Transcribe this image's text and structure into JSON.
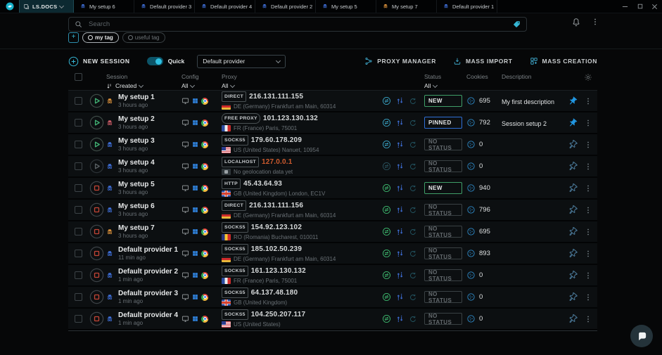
{
  "titlebar": {
    "app_label": "LS.DOCS",
    "tabs": [
      {
        "label": "My setup 6",
        "icon_color": "#3e6ed6"
      },
      {
        "label": "Default provider 3",
        "icon_color": "#3e6ed6"
      },
      {
        "label": "Default provider 4",
        "icon_color": "#3e6ed6"
      },
      {
        "label": "Default provider 2",
        "icon_color": "#3e6ed6"
      },
      {
        "label": "My setup 5",
        "icon_color": "#3e6ed6"
      },
      {
        "label": "My setup 7",
        "icon_color": "#d88f3a"
      },
      {
        "label": "Default provider 1",
        "icon_color": "#3e6ed6"
      }
    ]
  },
  "search": {
    "placeholder": "Search"
  },
  "tags": [
    {
      "label": "my tag",
      "active": true
    },
    {
      "label": "useful tag",
      "active": false
    }
  ],
  "toolbar": {
    "new_session": "NEW SESSION",
    "quick": "Quick",
    "provider": "Default provider",
    "proxy_manager": "PROXY MANAGER",
    "mass_import": "MASS IMPORT",
    "mass_creation": "MASS CREATION"
  },
  "table": {
    "header": {
      "session": "Session",
      "created": "Created",
      "config": "Config",
      "proxy": "Proxy",
      "status": "Status",
      "cookies": "Cookies",
      "description": "Description",
      "filter_all": "All"
    },
    "rows": [
      {
        "name": "My setup 1",
        "created": "3 hours ago",
        "person_color": "#d88f3a",
        "button": "play",
        "proxy_type": "DIRECT",
        "pill": false,
        "ip": "216.131.111.155",
        "ip_warn": false,
        "flag": "de",
        "geo": "DE (Germany) Frankfurt am Main, 60314",
        "check": "teal",
        "status_label": "NEW",
        "status_type": "new",
        "cookies": "695",
        "description": "My first description",
        "pinned": true
      },
      {
        "name": "My setup 2",
        "created": "3 hours ago",
        "person_color": "#c85b66",
        "button": "play",
        "proxy_type": "FREE PROXY",
        "pill": true,
        "ip": "101.123.130.132",
        "ip_warn": false,
        "flag": "fr",
        "geo": "FR (France) Paris, 75001",
        "check": "teal",
        "status_label": "PINNED",
        "status_type": "pinned",
        "cookies": "792",
        "description": "Session setup 2",
        "pinned": true
      },
      {
        "name": "My setup 3",
        "created": "3 hours ago",
        "person_color": "#3e6ed6",
        "button": "play",
        "proxy_type": "SOCKS5",
        "pill": false,
        "ip": "179.60.178.209",
        "ip_warn": false,
        "flag": "us",
        "geo": "US (United States) Nanuet, 10954",
        "check": "teal",
        "status_label": "NO STATUS",
        "status_type": "none",
        "cookies": "0",
        "description": "",
        "pinned": false
      },
      {
        "name": "My setup 4",
        "created": "3 hours ago",
        "person_color": "#3e6ed6",
        "button": "play-disabled",
        "proxy_type": "LOCALHOST",
        "pill": false,
        "ip": "127.0.0.1",
        "ip_warn": true,
        "flag": "unknown",
        "geo": "No geolocation data yet",
        "check": "dim",
        "status_label": "NO STATUS",
        "status_type": "none",
        "cookies": "0",
        "description": "",
        "pinned": false
      },
      {
        "name": "My setup 5",
        "created": "3 hours ago",
        "person_color": "#3e6ed6",
        "button": "stop",
        "proxy_type": "HTTP",
        "pill": false,
        "ip": "45.43.64.93",
        "ip_warn": false,
        "flag": "gb",
        "geo": "GB (United Kingdom) London, EC1V",
        "check": "green",
        "status_label": "NEW",
        "status_type": "new",
        "cookies": "940",
        "description": "",
        "pinned": false
      },
      {
        "name": "My setup 6",
        "created": "3 hours ago",
        "person_color": "#3e6ed6",
        "button": "stop",
        "proxy_type": "DIRECT",
        "pill": false,
        "ip": "216.131.111.156",
        "ip_warn": false,
        "flag": "de",
        "geo": "DE (Germany) Frankfurt am Main, 60314",
        "check": "green",
        "status_label": "NO STATUS",
        "status_type": "none",
        "cookies": "796",
        "description": "",
        "pinned": false
      },
      {
        "name": "My setup 7",
        "created": "3 hours ago",
        "person_color": "#d88f3a",
        "button": "stop",
        "proxy_type": "SOCKS5",
        "pill": false,
        "ip": "154.92.123.102",
        "ip_warn": false,
        "flag": "ro",
        "geo": "RO (Romania) Bucharest, 010011",
        "check": "green",
        "status_label": "NO STATUS",
        "status_type": "none",
        "cookies": "695",
        "description": "",
        "pinned": false
      },
      {
        "name": "Default provider 1",
        "created": "11 min ago",
        "person_color": "#3e6ed6",
        "button": "stop",
        "proxy_type": "SOCKS5",
        "pill": false,
        "ip": "185.102.50.239",
        "ip_warn": false,
        "flag": "de",
        "geo": "DE (Germany) Frankfurt am Main, 60314",
        "check": "green",
        "status_label": "NO STATUS",
        "status_type": "none",
        "cookies": "893",
        "description": "",
        "pinned": false
      },
      {
        "name": "Default provider 2",
        "created": "1 min ago",
        "person_color": "#3e6ed6",
        "button": "stop",
        "proxy_type": "SOCKS5",
        "pill": false,
        "ip": "161.123.130.132",
        "ip_warn": false,
        "flag": "fr",
        "geo": "FR (France) Paris, 75001",
        "check": "green",
        "status_label": "NO STATUS",
        "status_type": "none",
        "cookies": "0",
        "description": "",
        "pinned": false
      },
      {
        "name": "Default provider 3",
        "created": "1 min ago",
        "person_color": "#3e6ed6",
        "button": "stop",
        "proxy_type": "SOCKS5",
        "pill": false,
        "ip": "64.137.48.180",
        "ip_warn": false,
        "flag": "gb",
        "geo": "GB (United Kingdom)",
        "check": "green",
        "status_label": "NO STATUS",
        "status_type": "none",
        "cookies": "0",
        "description": "",
        "pinned": false
      },
      {
        "name": "Default provider 4",
        "created": "1 min ago",
        "person_color": "#3e6ed6",
        "button": "stop",
        "proxy_type": "SOCKS5",
        "pill": false,
        "ip": "104.250.207.117",
        "ip_warn": false,
        "flag": "us",
        "geo": "US (United States)",
        "check": "green",
        "status_label": "NO STATUS",
        "status_type": "none",
        "cookies": "0",
        "description": "",
        "pinned": false
      }
    ]
  },
  "colors": {
    "accent_teal": "#35b6d4",
    "green": "#3fbf72",
    "blue": "#3e6ed6",
    "red": "#c44536",
    "pin_active": "#2196e0",
    "pin_idle": "#4d7d9e",
    "check_teal": "#3aa7c9",
    "check_green": "#3fbf72",
    "check_dim": "#2a5460"
  }
}
